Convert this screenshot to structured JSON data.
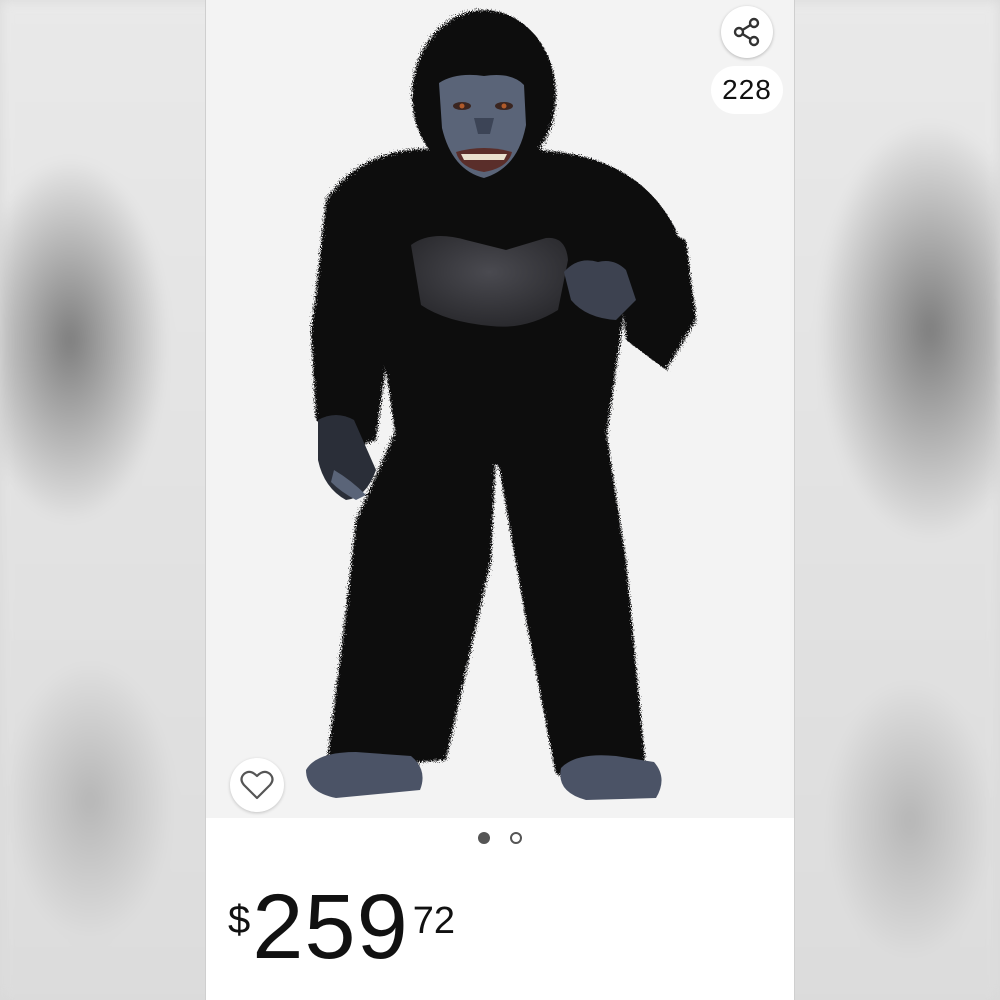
{
  "product": {
    "image_alt": "Gorilla costume",
    "share_count": "228",
    "carousel": {
      "total": 2,
      "active": 1
    },
    "price": {
      "currency": "$",
      "whole": "259",
      "fraction": "72"
    }
  },
  "icons": {
    "share": "share-icon",
    "wishlist": "heart-outline-icon"
  },
  "colors": {
    "fur": "#0c0c0f",
    "skin": "#5a6478",
    "background": "#f3f3f3",
    "text": "#111111"
  }
}
